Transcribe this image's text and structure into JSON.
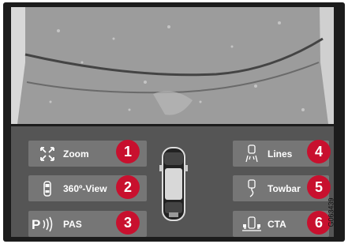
{
  "buttons": {
    "zoom": {
      "label": "Zoom",
      "number": "1",
      "icon": "zoom-arrows-icon"
    },
    "view": {
      "label": "360º-View",
      "number": "2",
      "icon": "car-360-icon"
    },
    "pas": {
      "label": "PAS",
      "number": "3",
      "icon": "park-assist-icon",
      "symbol": "P"
    },
    "lines": {
      "label": "Lines",
      "number": "4",
      "icon": "guide-lines-icon"
    },
    "towbar": {
      "label": "Towbar",
      "number": "5",
      "icon": "towbar-icon"
    },
    "cta": {
      "label": "CTA",
      "number": "6",
      "icon": "cross-traffic-alert-icon"
    }
  },
  "reference_code": "G063439",
  "colors": {
    "badge": "#c8102e",
    "panel": "#555555",
    "button": "#767676",
    "frame": "#1c1c1c"
  }
}
